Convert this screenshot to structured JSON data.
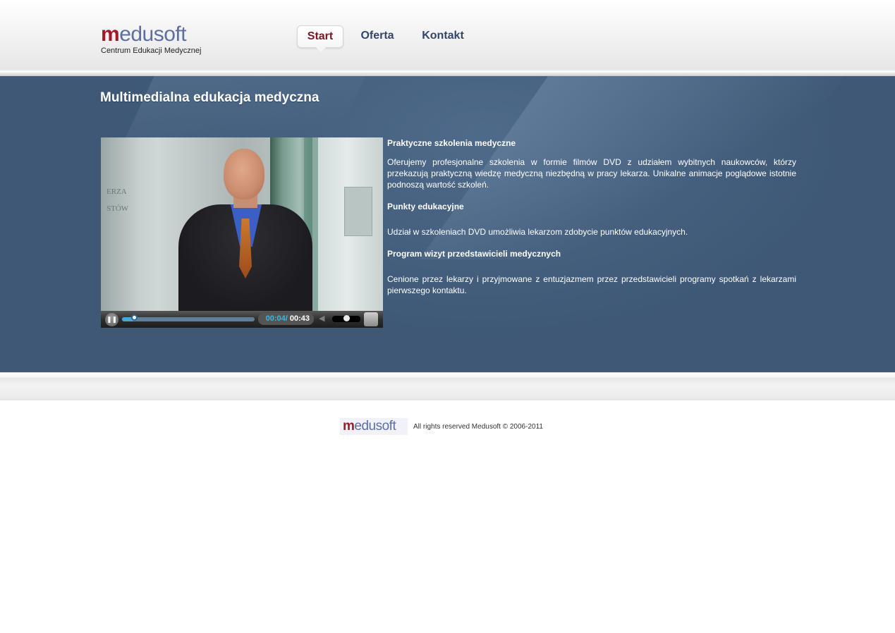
{
  "header": {
    "logo": {
      "mark": "m",
      "word_rest": "edusoft",
      "subtitle": "Centrum Edukacji Medycznej"
    },
    "nav": [
      {
        "label": "Start",
        "active": true
      },
      {
        "label": "Oferta",
        "active": false
      },
      {
        "label": "Kontakt",
        "active": false
      }
    ]
  },
  "main": {
    "title": "Multimedialna edukacja medyczna",
    "video": {
      "background_text_1": "ERZA",
      "background_text_2": "STÓW",
      "current_time": "00:04",
      "separator": "/",
      "total_time": "00:43",
      "progress": 0.093,
      "volume": 0.5,
      "state": "playing"
    },
    "sections": [
      {
        "heading": "Praktyczne szkolenia medyczne",
        "body": "Oferujemy profesjonalne szkolenia w formie filmów DVD z udziałem wybitnych naukowców, którzy przekazują praktyczną wiedzę medyczną niezbędną w pracy lekarza. Unikalne animacje poglądowe istotnie podnoszą wartość szkoleń."
      },
      {
        "heading": "Punkty edukacyjne",
        "body": "Udział w szkoleniach DVD umożliwia lekarzom zdobycie punktów edukacyjnych."
      },
      {
        "heading": "Program wizyt przedstawicieli medycznych",
        "body": "Cenione przez lekarzy i przyjmowane z entuzjazmem przez przedstawicieli programy spotkań z lekarzami pierwszego kontaktu."
      }
    ]
  },
  "footer": {
    "logo_mark": "m",
    "logo_rest": "edusoft",
    "copyright": "All rights reserved Medusoft © 2006-2011"
  },
  "colors": {
    "band": "#3e5876",
    "brand_red": "#a21a2a",
    "brand_blue": "#5d6fa0",
    "nav_text": "#33456a",
    "nav_active": "#7a1822",
    "time_accent": "#3fb6e0"
  },
  "icons": {
    "pause": "pause-icon",
    "volume": "speaker-icon",
    "fullscreen": "fullscreen-icon"
  }
}
